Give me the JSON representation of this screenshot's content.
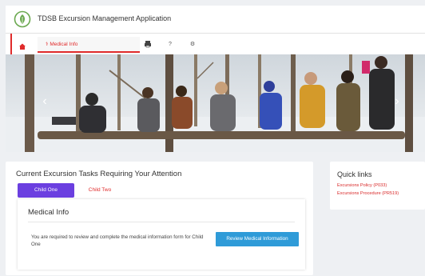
{
  "header": {
    "title": "TDSB Excursion Management Application",
    "logo_icon": "tdsb-leaf-logo"
  },
  "navbar": {
    "active_tab_label": "Medical Info",
    "accent_color": "#e02b2b",
    "icons": [
      "home-icon",
      "medical-icon",
      "print-icon",
      "help-icon",
      "settings-icon"
    ]
  },
  "hero": {
    "prev_icon": "chevron-left-icon",
    "next_icon": "chevron-right-icon",
    "prev_glyph": "‹",
    "next_glyph": "›"
  },
  "tasks": {
    "title": "Current Excursion Tasks Requiring Your Attention",
    "children": [
      {
        "label": "Child One",
        "active": true
      },
      {
        "label": "Child Two",
        "active": false
      }
    ],
    "medical": {
      "title": "Medical Info",
      "message": "You are required to review and complete the medical information form for Child One",
      "button_label": "Review Medical Information",
      "button_color": "#2f9bd8"
    },
    "active_tab_color": "#6b3fe0"
  },
  "quick_links": {
    "title": "Quick links",
    "links": [
      "Excursions Policy (P033)",
      "Excursions Procedure (PR519)"
    ]
  }
}
